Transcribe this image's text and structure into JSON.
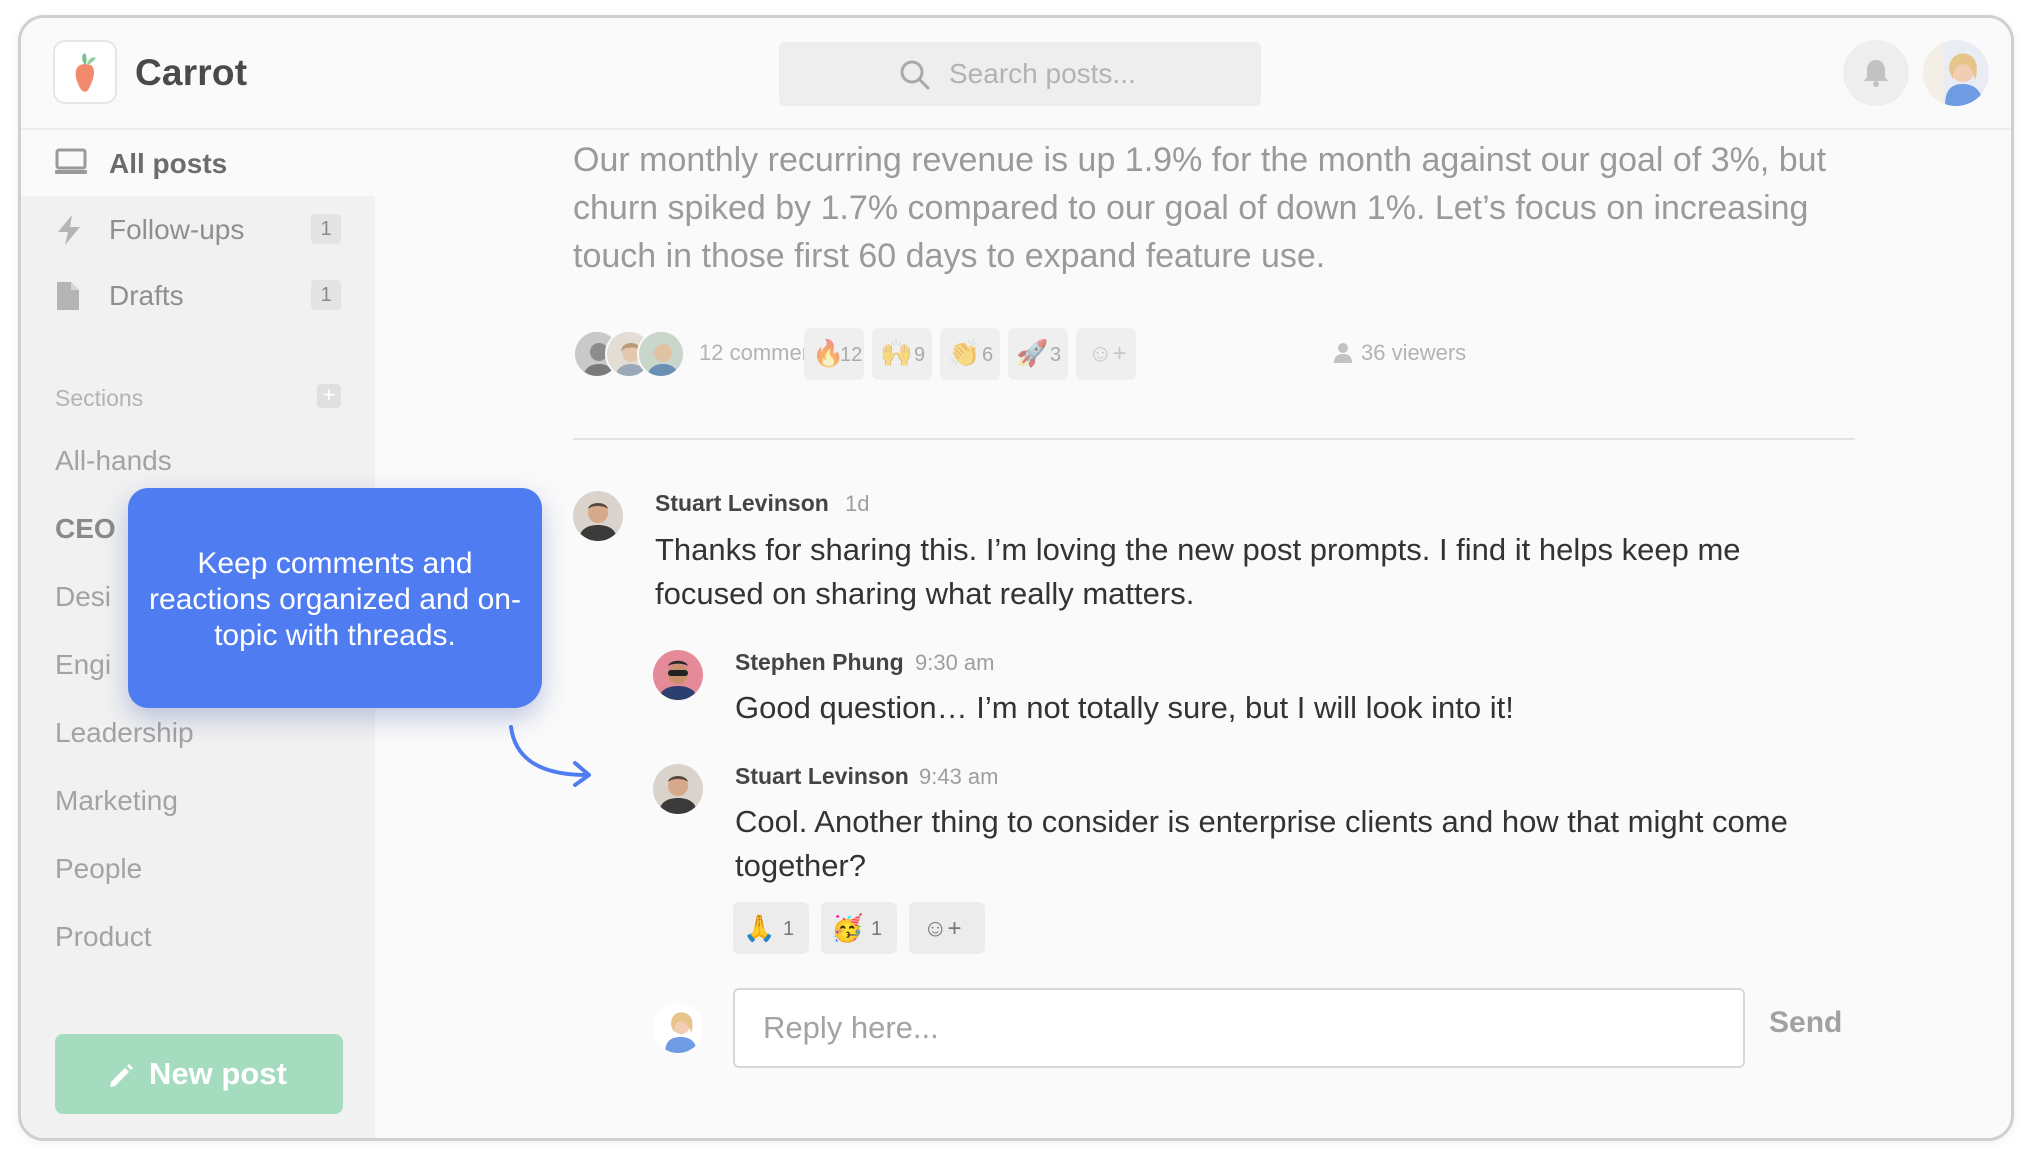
{
  "app": {
    "name": "Carrot"
  },
  "search": {
    "placeholder": "Search posts..."
  },
  "sidebar": {
    "nav": [
      {
        "label": "All posts",
        "icon": "monitor-icon",
        "active": true
      },
      {
        "label": "Follow-ups",
        "icon": "lightning-icon",
        "count": "1"
      },
      {
        "label": "Drafts",
        "icon": "document-icon",
        "count": "1"
      }
    ],
    "sections_label": "Sections",
    "sections": [
      "All-hands",
      "CEO",
      "Desi",
      "Engi",
      "Leadership",
      "Marketing",
      "People",
      "Product"
    ],
    "new_post_label": "New post"
  },
  "post": {
    "body": "Our monthly recurring revenue is up 1.9% for the month against our goal of 3%, but churn spiked by 1.7% compared to our goal of down 1%. Let’s focus on increasing touch in those first 60 days to expand feature use.",
    "comments_label": "12 comments",
    "reactions": [
      {
        "emoji": "🔥",
        "count": "12"
      },
      {
        "emoji": "🙌",
        "count": "9"
      },
      {
        "emoji": "👏",
        "count": "6"
      },
      {
        "emoji": "🚀",
        "count": "3"
      }
    ],
    "add_reaction": "☺+",
    "viewers_label": "36 viewers"
  },
  "comments": [
    {
      "name": "Stuart Levinson",
      "time": "1d",
      "text": "Thanks for sharing this. I’m loving the new post prompts. I find it helps keep me focused on sharing what really matters."
    },
    {
      "name": "Stephen Phung",
      "time": "9:30 am",
      "text": "Good question… I’m not totally sure, but I will look into it!"
    },
    {
      "name": "Stuart Levinson",
      "time": "9:43 am",
      "text": "Cool. Another thing to consider is enterprise clients and how that might come together?",
      "reactions": [
        {
          "emoji": "🙏",
          "count": "1"
        },
        {
          "emoji": "🥳",
          "count": "1"
        }
      ]
    }
  ],
  "reply": {
    "placeholder": "Reply here...",
    "send_label": "Send"
  },
  "callout": {
    "text": "Keep comments and reactions organized and on-topic with threads."
  },
  "colors": {
    "accent_blue": "#4f7cf0",
    "new_post_green": "#a5dcc0",
    "background": "#fafafa"
  }
}
